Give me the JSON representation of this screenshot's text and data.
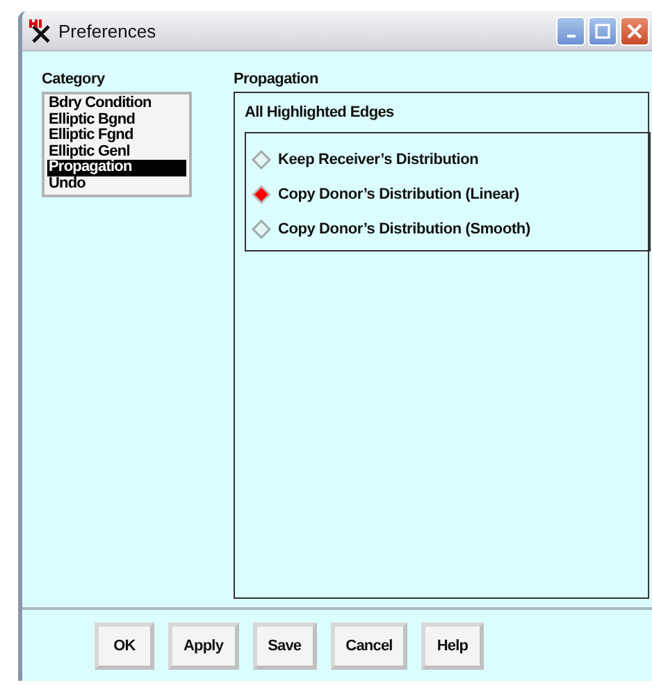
{
  "window": {
    "title": "Preferences"
  },
  "category": {
    "label": "Category",
    "items": [
      {
        "label": "Bdry Condition",
        "selected": false
      },
      {
        "label": "Elliptic Bgnd",
        "selected": false
      },
      {
        "label": "Elliptic Fgnd",
        "selected": false
      },
      {
        "label": "Elliptic Genl",
        "selected": false
      },
      {
        "label": "Propagation",
        "selected": true
      },
      {
        "label": "Undo",
        "selected": false
      }
    ]
  },
  "panel": {
    "title": "Propagation",
    "group_title": "All Highlighted Edges",
    "options": [
      {
        "label": "Keep Receiver’s Distribution",
        "selected": false
      },
      {
        "label": "Copy Donor’s Distribution (Linear)",
        "selected": true
      },
      {
        "label": "Copy Donor’s Distribution (Smooth)",
        "selected": false
      }
    ]
  },
  "buttons": [
    "OK",
    "Apply",
    "Save",
    "Cancel",
    "Help"
  ]
}
